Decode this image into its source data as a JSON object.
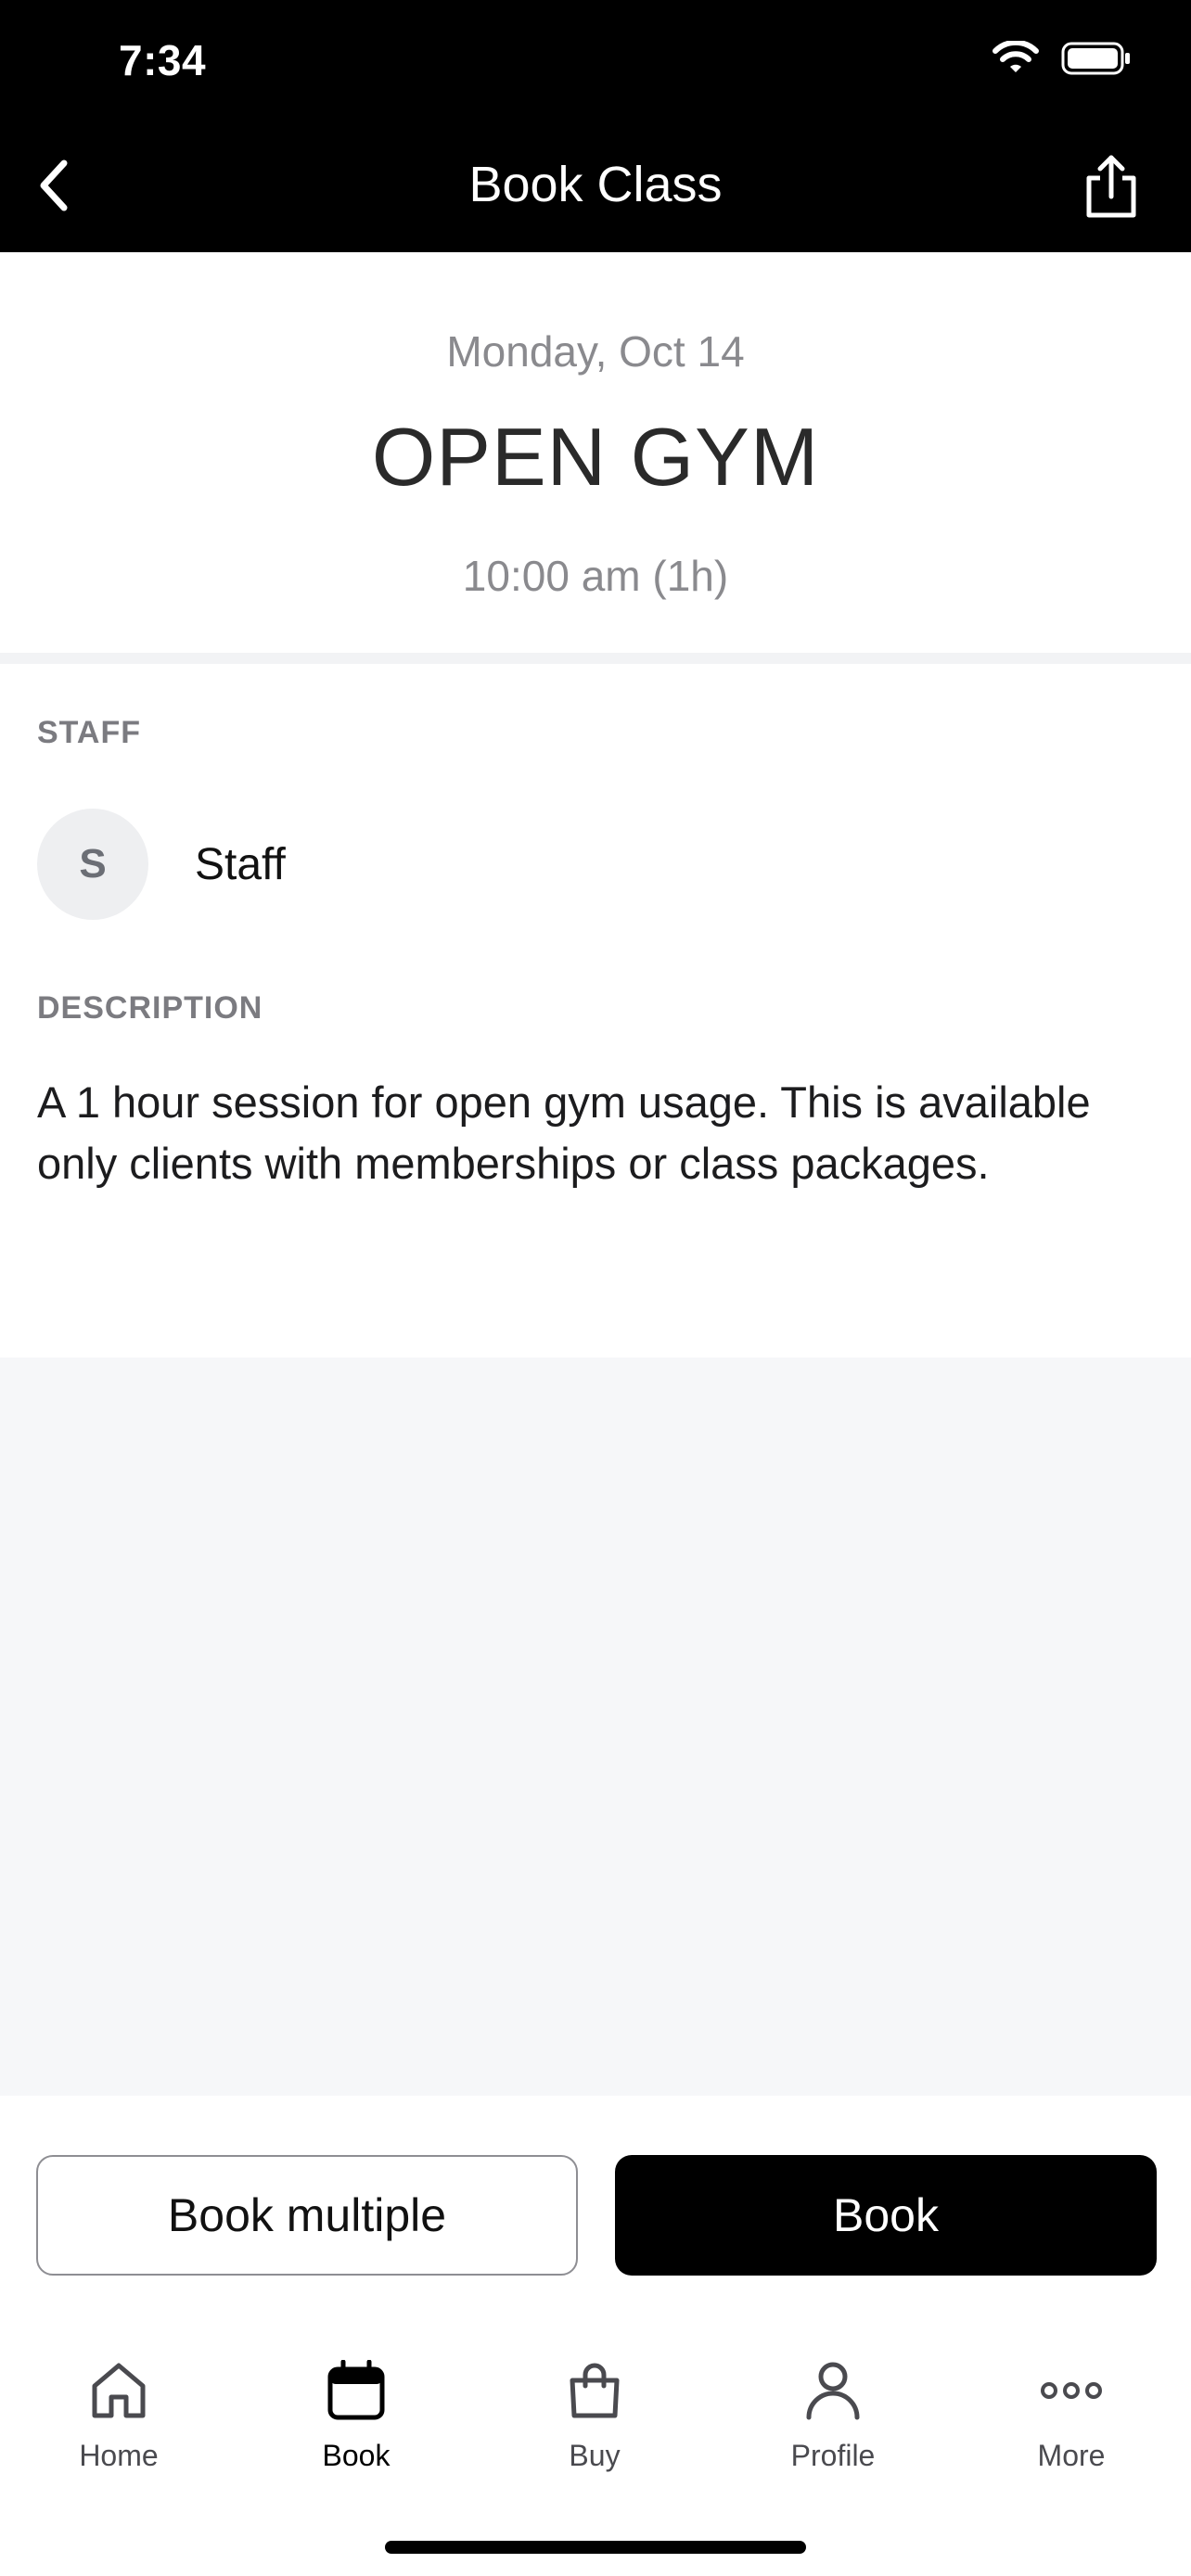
{
  "status_bar": {
    "time": "7:34"
  },
  "nav": {
    "title": "Book Class"
  },
  "class_info": {
    "date": "Monday, Oct 14",
    "title": "OPEN GYM",
    "time": "10:00 am (1h)"
  },
  "staff": {
    "label": "STAFF",
    "avatar_initial": "S",
    "name": "Staff"
  },
  "description": {
    "label": "DESCRIPTION",
    "text": "A 1 hour session for open gym usage. This is available only clients with memberships or class packages."
  },
  "actions": {
    "book_multiple_label": "Book multiple",
    "book_label": "Book"
  },
  "tabs": [
    {
      "label": "Home",
      "icon": "home-icon",
      "active": false
    },
    {
      "label": "Book",
      "icon": "calendar-icon",
      "active": true
    },
    {
      "label": "Buy",
      "icon": "shopping-bag-icon",
      "active": false
    },
    {
      "label": "Profile",
      "icon": "person-icon",
      "active": false
    },
    {
      "label": "More",
      "icon": "more-dots-icon",
      "active": false
    }
  ],
  "colors": {
    "header_bg": "#000000",
    "primary_button": "#000000",
    "muted_text": "#8a8a8e",
    "empty_area_bg": "#f6f7f9"
  }
}
